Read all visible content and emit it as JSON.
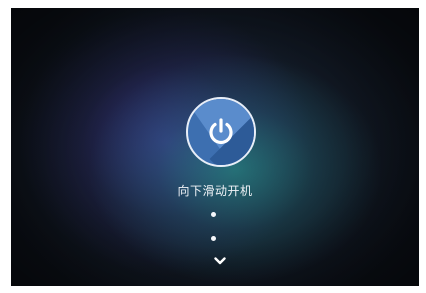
{
  "lock_screen": {
    "hint_text": "向下滑动开机",
    "power_icon": "power-icon",
    "indicator_icon": "chevron-down-icon",
    "colors": {
      "button_fill": "#3d6fb0",
      "button_border": "#e8eef8",
      "text": "#f2f4f8",
      "background_dark": "#0b0f16",
      "glow_teal": "#28aa96",
      "glow_purple": "#463caa"
    }
  }
}
